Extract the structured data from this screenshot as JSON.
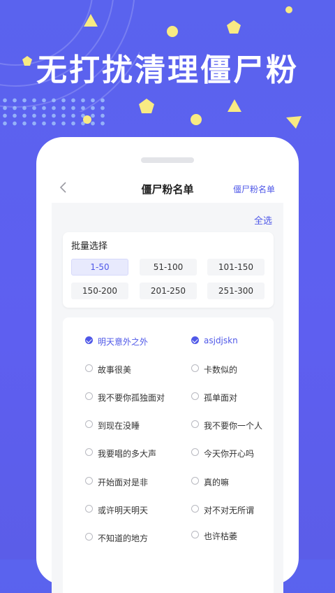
{
  "headline": "无打扰清理僵尸粉",
  "colors": {
    "accent": "#4f58e8",
    "background": "#5a63ee",
    "decor_yellow": "#f8ea83"
  },
  "nav": {
    "back_icon": "chevron-left-icon",
    "title": "僵尸粉名单",
    "right_link": "僵尸粉名单"
  },
  "select_all": "全选",
  "batch": {
    "title": "批量选择",
    "ranges": [
      "1-50",
      "51-100",
      "101-150",
      "150-200",
      "201-250",
      "251-300"
    ],
    "selected_range": "1-50"
  },
  "fans": [
    {
      "name": "明天意外之外",
      "checked": true
    },
    {
      "name": "asjdjskn",
      "checked": true
    },
    {
      "name": "故事很美",
      "checked": false
    },
    {
      "name": "卡数似的",
      "checked": false
    },
    {
      "name": "我不要你孤独面对",
      "checked": false
    },
    {
      "name": "孤单面对",
      "checked": false
    },
    {
      "name": "到现在没睡",
      "checked": false
    },
    {
      "name": "我不要你一个人",
      "checked": false
    },
    {
      "name": "我要唱的多大声",
      "checked": false
    },
    {
      "name": "今天你开心吗",
      "checked": false
    },
    {
      "name": "开始面对是非",
      "checked": false
    },
    {
      "name": "真的嘛",
      "checked": false
    },
    {
      "name": "或许明天明天",
      "checked": false
    },
    {
      "name": "对不对无所谓",
      "checked": false
    },
    {
      "name": "不知道的地方",
      "checked": false
    },
    {
      "name": "也许枯萎",
      "checked": false
    }
  ]
}
